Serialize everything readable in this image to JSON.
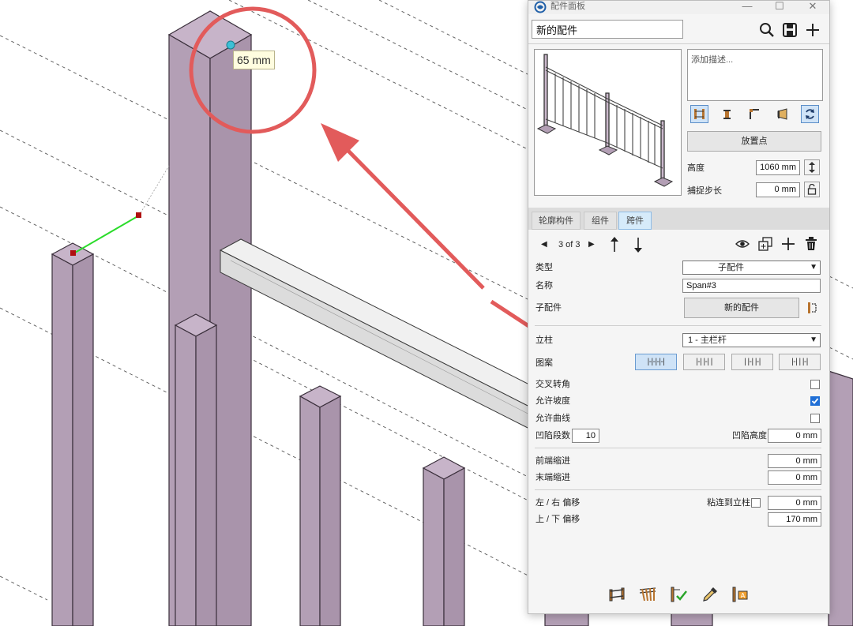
{
  "viewport": {
    "dimension_label": "65 mm",
    "colors": {
      "post_fill": "#b39fb5",
      "post_edge": "#3a2f3b",
      "rail_fill": "#e3e3e3",
      "annotation": "#e25b5b",
      "guide": "#2bdc2b"
    }
  },
  "window": {
    "title": "配件面板",
    "minimize_glyph": "—",
    "maximize_glyph": "☐",
    "close_glyph": "✕"
  },
  "header": {
    "name_value": "新的配件",
    "icons": [
      "search-icon",
      "save-icon",
      "add-icon"
    ]
  },
  "properties": {
    "description_placeholder": "添加描述...",
    "place_point_label": "放置点",
    "height_label": "高度",
    "height_value": "1060 mm",
    "snap_step_label": "捕捉步长",
    "snap_step_value": "0 mm"
  },
  "tabs": [
    {
      "label": "轮廓构件",
      "active": false
    },
    {
      "label": "组件",
      "active": false
    },
    {
      "label": "跨件",
      "active": true
    }
  ],
  "span": {
    "pager_text": "3 of 3",
    "type_label": "类型",
    "type_value": "子配件",
    "name_label": "名称",
    "name_value": "Span#3",
    "subassembly_label": "子配件",
    "subassembly_button": "新的配件",
    "post_label": "立柱",
    "post_value": "1 - 主栏杆",
    "pattern_label": "图案",
    "patterns": [
      "|-|-|-|-|",
      "|-| |-| |",
      "| |-| |-|",
      "|-| | |-|"
    ],
    "cross_corner_label": "交叉转角",
    "cross_corner_checked": false,
    "allow_slope_label": "允许坡度",
    "allow_slope_checked": true,
    "allow_curve_label": "允许曲线",
    "allow_curve_checked": false,
    "recess_count_label": "凹陷段数",
    "recess_count_value": "10",
    "recess_height_label": "凹陷高度",
    "recess_height_value": "0 mm",
    "start_inset_label": "前端缩进",
    "start_inset_value": "0 mm",
    "end_inset_label": "末端缩进",
    "end_inset_value": "0 mm",
    "lr_offset_label": "左 / 右 偏移",
    "stick_to_post_label": "粘连到立柱",
    "stick_to_post_checked": false,
    "lr_offset_value": "0 mm",
    "ud_offset_label": "上 / 下 偏移",
    "ud_offset_value": "170 mm"
  },
  "bottom_tools": [
    "railing-tool-icon",
    "fence-tool-icon",
    "railing-check-icon",
    "eyedropper-icon",
    "post-label-icon"
  ]
}
